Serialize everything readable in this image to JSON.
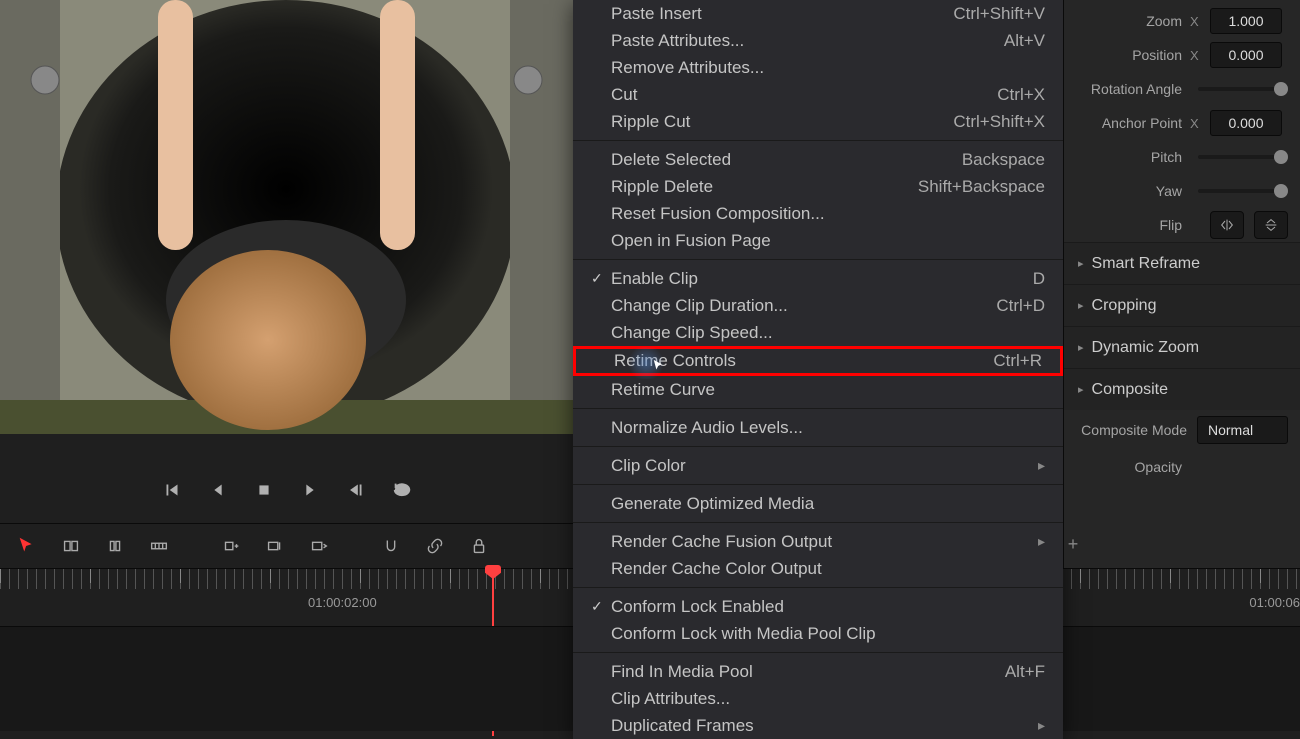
{
  "contextMenu": {
    "groups": [
      [
        {
          "label": "Paste Insert",
          "shortcut": "Ctrl+Shift+V"
        },
        {
          "label": "Paste Attributes...",
          "shortcut": "Alt+V"
        },
        {
          "label": "Remove Attributes..."
        },
        {
          "label": "Cut",
          "shortcut": "Ctrl+X"
        },
        {
          "label": "Ripple Cut",
          "shortcut": "Ctrl+Shift+X"
        }
      ],
      [
        {
          "label": "Delete Selected",
          "shortcut": "Backspace"
        },
        {
          "label": "Ripple Delete",
          "shortcut": "Shift+Backspace"
        },
        {
          "label": "Reset Fusion Composition..."
        },
        {
          "label": "Open in Fusion Page"
        }
      ],
      [
        {
          "label": "Enable Clip",
          "shortcut": "D",
          "checked": true
        },
        {
          "label": "Change Clip Duration...",
          "shortcut": "Ctrl+D"
        },
        {
          "label": "Change Clip Speed..."
        },
        {
          "label": "Retime Controls",
          "shortcut": "Ctrl+R",
          "highlighted": true
        },
        {
          "label": "Retime Curve"
        }
      ],
      [
        {
          "label": "Normalize Audio Levels..."
        }
      ],
      [
        {
          "label": "Clip Color",
          "submenu": true
        }
      ],
      [
        {
          "label": "Generate Optimized Media"
        }
      ],
      [
        {
          "label": "Render Cache Fusion Output",
          "submenu": true
        },
        {
          "label": "Render Cache Color Output"
        }
      ],
      [
        {
          "label": "Conform Lock Enabled",
          "checked": true
        },
        {
          "label": "Conform Lock with Media Pool Clip"
        }
      ],
      [
        {
          "label": "Find In Media Pool",
          "shortcut": "Alt+F"
        },
        {
          "label": "Clip Attributes..."
        },
        {
          "label": "Duplicated Frames",
          "submenu": true
        }
      ]
    ]
  },
  "inspector": {
    "transform": {
      "zoom_label": "Zoom",
      "zoom_axis": "X",
      "zoom_value": "1.000",
      "position_label": "Position",
      "position_axis": "X",
      "position_value": "0.000",
      "rotation_label": "Rotation Angle",
      "anchor_label": "Anchor Point",
      "anchor_axis": "X",
      "anchor_value": "0.000",
      "pitch_label": "Pitch",
      "yaw_label": "Yaw",
      "flip_label": "Flip"
    },
    "sections": {
      "smart_reframe": "Smart Reframe",
      "cropping": "Cropping",
      "dynamic_zoom": "Dynamic Zoom",
      "composite": "Composite"
    },
    "composite": {
      "mode_label": "Composite Mode",
      "mode_value": "Normal",
      "opacity_label": "Opacity"
    }
  },
  "timeline": {
    "timecode": "01:00:02:00",
    "timecode_right": "01:00:06"
  }
}
